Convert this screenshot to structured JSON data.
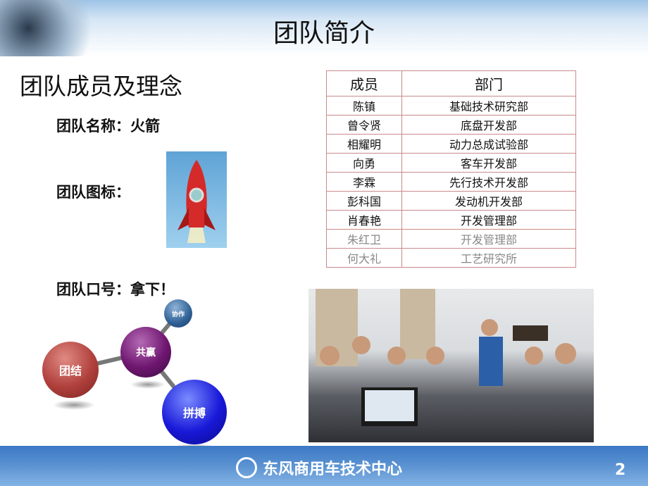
{
  "title": "团队简介",
  "subtitle": "团队成员及理念",
  "team_name": "团队名称：火箭",
  "team_icon": "团队图标：",
  "team_slogan": "团队口号：拿下！",
  "values": {
    "a": "协作",
    "b": "共赢",
    "c": "团结",
    "d": "拼搏"
  },
  "table": {
    "headers": [
      "成员",
      "部门"
    ],
    "rows": [
      [
        "陈镇",
        "基础技术研究部"
      ],
      [
        "曾令贤",
        "底盘开发部"
      ],
      [
        "相耀明",
        "动力总成试验部"
      ],
      [
        "向勇",
        "客车开发部"
      ],
      [
        "李霖",
        "先行技术开发部"
      ],
      [
        "彭科国",
        "发动机开发部"
      ],
      [
        "肖春艳",
        "开发管理部"
      ],
      [
        "朱红卫",
        "开发管理部"
      ],
      [
        "何大礼",
        "工艺研究所"
      ]
    ]
  },
  "footer": {
    "brand": "东风商用车技术中心",
    "page": "2"
  },
  "colors": {
    "footer": "#3b78c4",
    "table_border": "#c98a8a"
  }
}
